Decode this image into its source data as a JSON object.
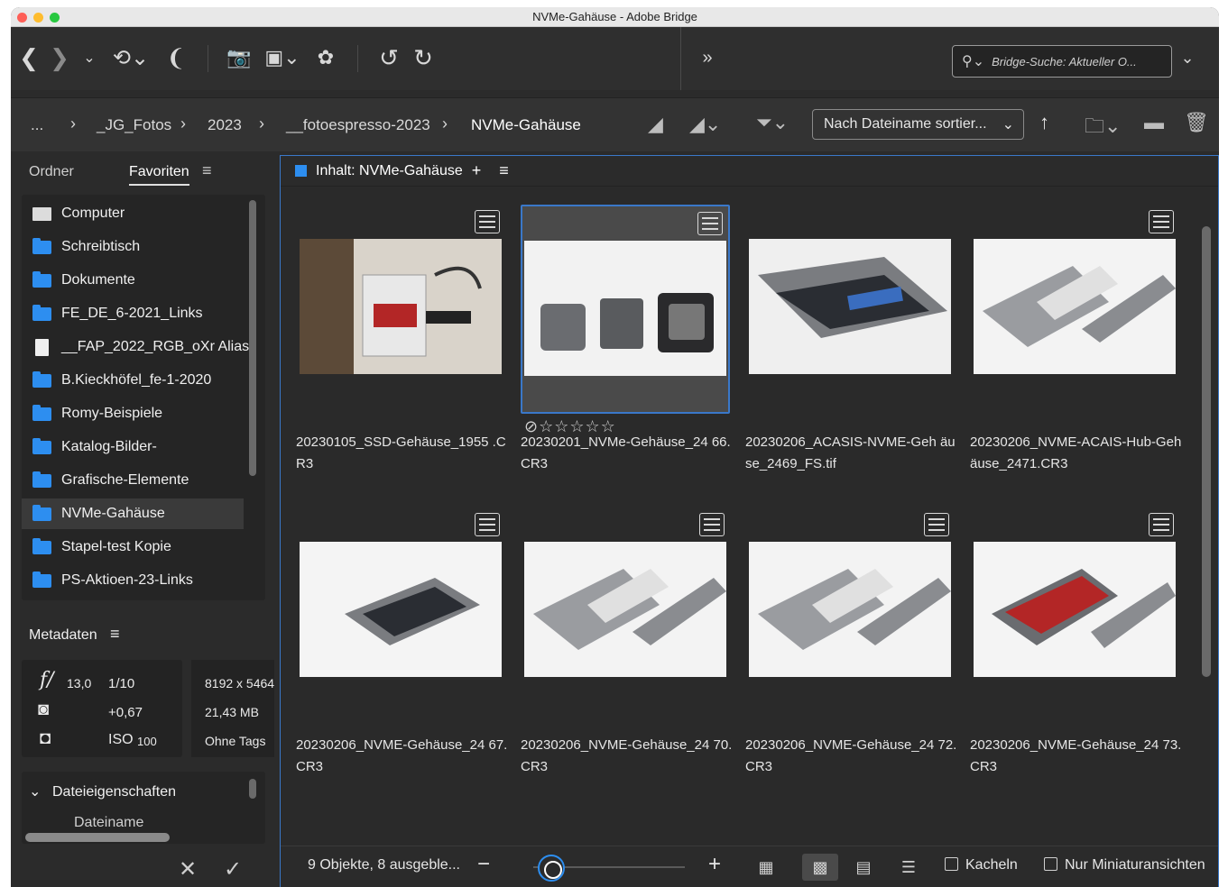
{
  "window": {
    "title": "NVMe-Gahäuse - Adobe Bridge"
  },
  "toolbar": {
    "search_placeholder": "Bridge-Suche: Aktueller O..."
  },
  "path": {
    "crumbs": [
      "...",
      "_JG_Fotos",
      "2023",
      "__fotoespresso-2023",
      "NVMe-Gahäuse"
    ],
    "sort_label": "Nach Dateiname sortier..."
  },
  "left": {
    "tab_folders": "Ordner",
    "tab_favorites": "Favoriten",
    "favorites": [
      {
        "label": "Computer",
        "icon": "computer-icon"
      },
      {
        "label": "Schreibtisch",
        "icon": "folder-icon"
      },
      {
        "label": "Dokumente",
        "icon": "folder-icon"
      },
      {
        "label": "FE_DE_6-2021_Links",
        "icon": "folder-icon"
      },
      {
        "label": "__FAP_2022_RGB_oXr Alias",
        "icon": "document-icon"
      },
      {
        "label": "B.Kieckhöfel_fe-1-2020",
        "icon": "folder-icon"
      },
      {
        "label": "Romy-Beispiele",
        "icon": "folder-icon"
      },
      {
        "label": "Katalog-Bilder-",
        "icon": "folder-icon"
      },
      {
        "label": "Grafische-Elemente",
        "icon": "folder-icon"
      },
      {
        "label": "NVMe-Gahäuse",
        "icon": "folder-icon",
        "selected": true
      },
      {
        "label": "Stapel-test Kopie",
        "icon": "folder-icon"
      },
      {
        "label": "PS-Aktioen-23-Links",
        "icon": "folder-icon"
      }
    ],
    "metadata_title": "Metadaten",
    "metadata": {
      "aperture_symbol": "f/",
      "aperture": "13,0",
      "shutter": "1/10",
      "exposure_comp": "+0,67",
      "iso_label": "ISO",
      "iso": "100",
      "dimensions": "8192 x 5464",
      "filesize": "21,43 MB",
      "tags": "Ohne Tags"
    },
    "fileprops_title": "Dateieigenschaften",
    "fileprops_first": "Dateiname"
  },
  "content": {
    "header": "Inhalt: NVMe-Gahäuse",
    "items": [
      {
        "name": "20230105_SSD-Gehäuse_1955 .CR3",
        "style": "dark"
      },
      {
        "name": "20230201_NVMe-Gehäuse_24 66.CR3",
        "selected": true,
        "rating": "☆☆☆☆☆"
      },
      {
        "name": "20230206_ACASIS-NVME-Geh äuse_2469_FS.tif"
      },
      {
        "name": "20230206_NVME-ACAIS-Hub-Gehäuse_2471.CR3"
      },
      {
        "name": "20230206_NVME-Gehäuse_24 67.CR3"
      },
      {
        "name": "20230206_NVME-Gehäuse_24 70.CR3"
      },
      {
        "name": "20230206_NVME-Gehäuse_24 72.CR3"
      },
      {
        "name": "20230206_NVME-Gehäuse_24 73.CR3"
      }
    ],
    "status": "9 Objekte, 8 ausgeble...",
    "zoom_fraction": 0.12,
    "checkbox_tiles": "Kacheln",
    "checkbox_thumbs": "Nur Miniaturansichten"
  },
  "colors": {
    "accent": "#2d8ef0",
    "selection_border": "#3a78c9"
  }
}
